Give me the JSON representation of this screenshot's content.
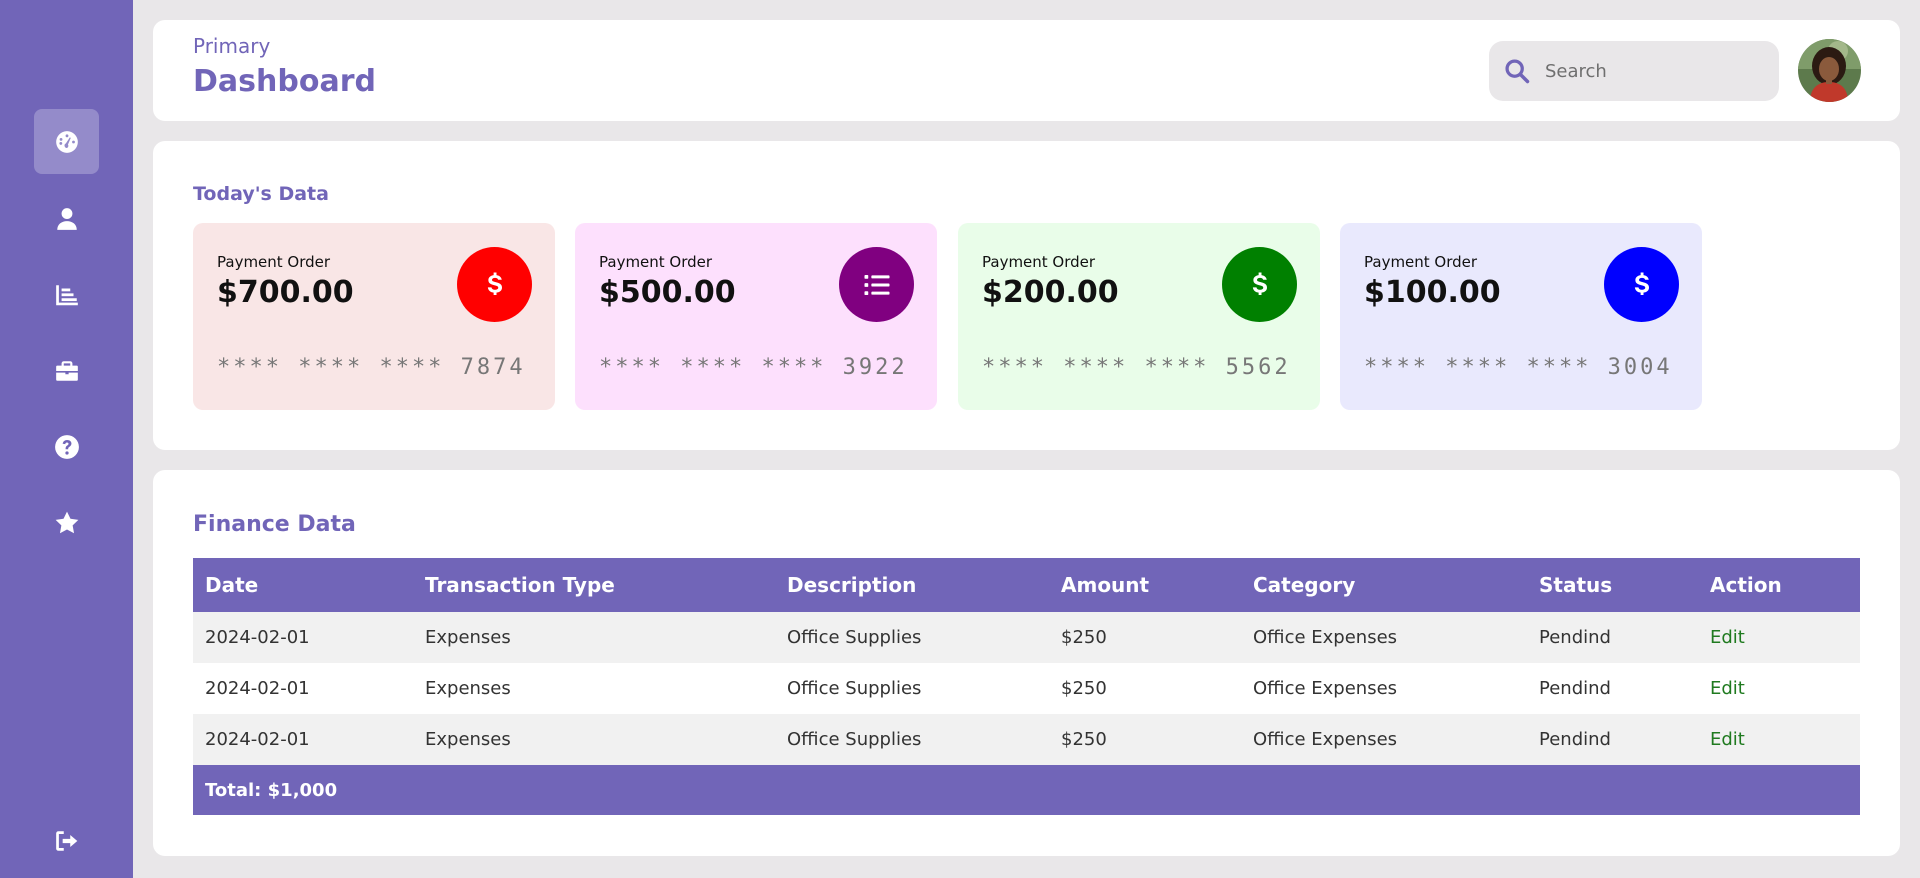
{
  "header": {
    "subtitle": "Primary",
    "title": "Dashboard",
    "search_placeholder": "Search"
  },
  "sidebar": {
    "items": [
      {
        "icon": "dashboard-icon",
        "active": true
      },
      {
        "icon": "user-icon"
      },
      {
        "icon": "chart-icon"
      },
      {
        "icon": "briefcase-icon"
      },
      {
        "icon": "help-icon"
      },
      {
        "icon": "star-icon"
      }
    ],
    "logout_icon": "logout-icon"
  },
  "today": {
    "title": "Today's Data",
    "cards": [
      {
        "label": "Payment Order",
        "amount": "$700.00",
        "number": "**** **** **** 7874",
        "icon": "dollar-icon",
        "color": "#ff0000",
        "bg": "#f9e6e6"
      },
      {
        "label": "Payment Order",
        "amount": "$500.00",
        "number": "**** **** **** 3922",
        "icon": "list-icon",
        "color": "#800080",
        "bg": "#fde0fd"
      },
      {
        "label": "Payment Order",
        "amount": "$200.00",
        "number": "**** **** **** 5562",
        "icon": "dollar-icon",
        "color": "#008000",
        "bg": "#e9fde9"
      },
      {
        "label": "Payment Order",
        "amount": "$100.00",
        "number": "**** **** **** 3004",
        "icon": "dollar-icon",
        "color": "#0000ff",
        "bg": "#e9e9fd"
      }
    ]
  },
  "finance": {
    "title": "Finance Data",
    "columns": [
      "Date",
      "Transaction Type",
      "Description",
      "Amount",
      "Category",
      "Status",
      "Action"
    ],
    "rows": [
      [
        "2024-02-01",
        "Expenses",
        "Office Supplies",
        "$250",
        "Office Expenses",
        "Pendind",
        "Edit"
      ],
      [
        "2024-02-01",
        "Expenses",
        "Office Supplies",
        "$250",
        "Office Expenses",
        "Pendind",
        "Edit"
      ],
      [
        "2024-02-01",
        "Expenses",
        "Office Supplies",
        "$250",
        "Office Expenses",
        "Pendind",
        "Edit"
      ]
    ],
    "total": "Total: $1,000"
  },
  "colors": {
    "accent": "#7165b8",
    "edit_link": "#1f7a1f"
  }
}
